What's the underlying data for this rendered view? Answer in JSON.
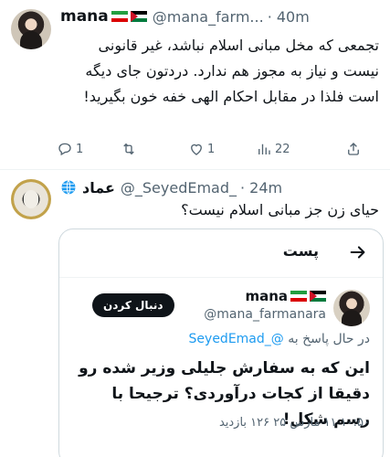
{
  "tweet1": {
    "name": "mana",
    "handle": "@mana_farm...",
    "time": "· 40m",
    "text": "تجمعی که مخل مبانی اسلام نباشد، غیر قانونی نیست و نیاز به مجوز هم ندارد. دردتون جای دیگه است فلذا در مقابل احکام الهی خفه خون بگیرید!",
    "replies": "1",
    "retweets": "",
    "likes": "1",
    "views": "22",
    "icons": [
      "reply-icon",
      "retweet-icon",
      "like-icon",
      "views-icon",
      "share-icon"
    ]
  },
  "tweet2": {
    "name": "عماد",
    "handle": "@_SeyedEmad_",
    "time": "· 24m",
    "text": "حیای زن جز مبانی اسلام نیست؟"
  },
  "quote_card": {
    "title": "پست",
    "name": "mana",
    "handle": "@mana_farmanara",
    "follow_label": "دنبال کردن",
    "reply_prefix": "در حال پاسخ به",
    "reply_mention": "@_SeyedEmad",
    "text": "این که به سفارش جلیلی وزیر شده رو دقیقا از کجات درآوردی؟ ترجیحا با رسم شکل!",
    "meta": "۱۰:۵۰ ۱۱ مارس ۲۵ ۱۲۶ بازدید"
  },
  "colors": {
    "text": "#0f1419",
    "muted": "#536471",
    "link": "#1d9bf0",
    "border": "#cfd9de"
  }
}
